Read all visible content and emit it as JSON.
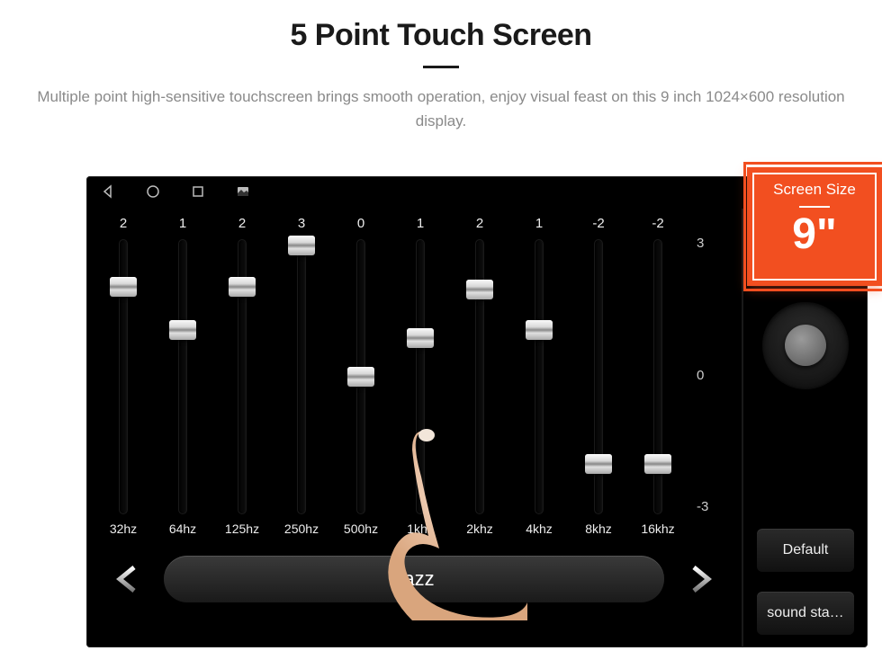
{
  "header": {
    "title": "5 Point Touch Screen",
    "subtitle": "Multiple point high-sensitive touchscreen brings smooth operation, enjoy visual feast on this 9 inch 1024×600 resolution display."
  },
  "badge": {
    "label": "Screen Size",
    "value": "9\""
  },
  "equalizer": {
    "scale": {
      "max": "3",
      "mid": "0",
      "min": "-3"
    },
    "bands": [
      {
        "freq": "32hz",
        "value": "2",
        "pos": 0.17
      },
      {
        "freq": "64hz",
        "value": "1",
        "pos": 0.33
      },
      {
        "freq": "125hz",
        "value": "2",
        "pos": 0.17
      },
      {
        "freq": "250hz",
        "value": "3",
        "pos": 0.02
      },
      {
        "freq": "500hz",
        "value": "0",
        "pos": 0.5
      },
      {
        "freq": "1khz",
        "value": "1",
        "pos": 0.36
      },
      {
        "freq": "2khz",
        "value": "2",
        "pos": 0.18
      },
      {
        "freq": "4khz",
        "value": "1",
        "pos": 0.33
      },
      {
        "freq": "8khz",
        "value": "-2",
        "pos": 0.82
      },
      {
        "freq": "16khz",
        "value": "-2",
        "pos": 0.82
      }
    ],
    "preset": "Jazz"
  },
  "side": {
    "default_label": "Default",
    "sound_label": "sound sta…"
  }
}
